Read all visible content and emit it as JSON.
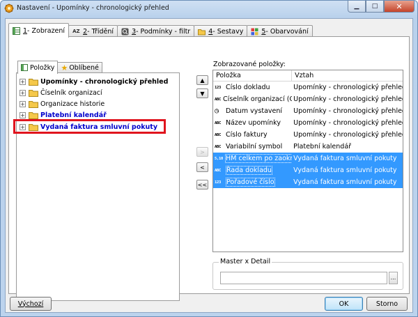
{
  "window": {
    "title": "Nastavení - Upomínky - chronologický přehled"
  },
  "main_tabs": [
    {
      "num": "1",
      "label": " - Zobrazení"
    },
    {
      "num": "2",
      "label": " - Třídění"
    },
    {
      "num": "3",
      "label": " - Podmínky - filtr"
    },
    {
      "num": "4",
      "label": " - Sestavy"
    },
    {
      "num": "5",
      "label": " - Obarvování"
    }
  ],
  "sub_tabs": [
    {
      "label": "Položky"
    },
    {
      "label": "Oblíbené"
    }
  ],
  "tree": [
    {
      "label": "Upomínky - chronologický přehled",
      "style": "bold"
    },
    {
      "label": "Číselník organizací",
      "style": "normal"
    },
    {
      "label": "Organizace historie",
      "style": "normal"
    },
    {
      "label": "Platební kalendář",
      "style": "blue"
    },
    {
      "label": "Vydaná faktura smluvní pokuty",
      "style": "blue"
    }
  ],
  "arrows": {
    "up": "▲",
    "down": "▼",
    "add": ">",
    "remove": "<",
    "remove_all": "<<"
  },
  "list": {
    "label": "Zobrazované položky:",
    "columns": [
      "Položka",
      "Vztah"
    ],
    "rows": [
      {
        "type": "123",
        "item": "Číslo dokladu",
        "rel": "Upomínky - chronologický přehled",
        "selected": false
      },
      {
        "type": "ABC",
        "item": "Číselník organizací (Organizace)",
        "rel": "Upomínky - chronologický přehled",
        "selected": false
      },
      {
        "type": "clock",
        "item": "Datum vystavení",
        "rel": "Upomínky - chronologický přehled",
        "selected": false
      },
      {
        "type": "ABC",
        "item": "Název upomínky",
        "rel": "Upomínky - chronologický přehled",
        "selected": false
      },
      {
        "type": "ABC",
        "item": "Číslo faktury",
        "rel": "Upomínky - chronologický přehled",
        "selected": false
      },
      {
        "type": "ABC",
        "item": "Variabilní symbol",
        "rel": "Platební kalendář",
        "selected": false
      },
      {
        "type": "5,10",
        "item": "HM celkem po zaokrouhlení",
        "rel": "Vydaná faktura smluvní pokuty",
        "selected": true
      },
      {
        "type": "ABC",
        "item": "Řada dokladu",
        "rel": "Vydaná faktura smluvní pokuty",
        "selected": true
      },
      {
        "type": "123",
        "item": "Pořadové číslo",
        "rel": "Vydaná faktura smluvní pokuty",
        "selected": true
      }
    ]
  },
  "master": {
    "label": "Master x Detail",
    "value": "",
    "browse": "..."
  },
  "buttons": {
    "default": "Výchozí",
    "ok": "OK",
    "cancel": "Storno"
  }
}
